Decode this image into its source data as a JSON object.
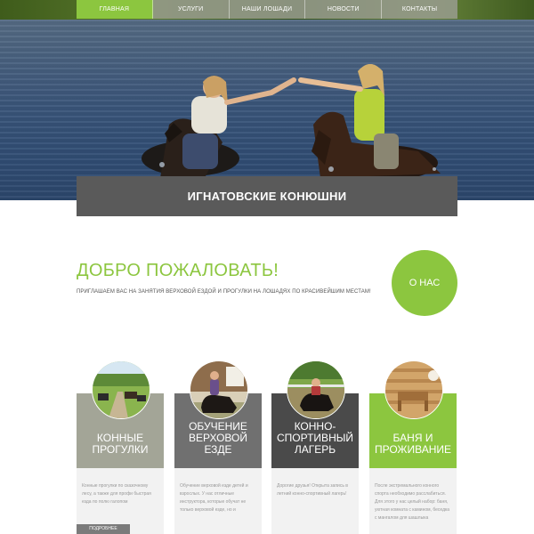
{
  "nav": {
    "items": [
      "Главная",
      "Услуги",
      "Наши лошади",
      "Новости",
      "Контакты"
    ],
    "active_color": "#8cc63f",
    "inactive_color": "#9a9d8c"
  },
  "hero": {
    "title": "ИГНАТОВСКИЕ КОНЮШНИ",
    "banner_color": "#5a5a5a"
  },
  "welcome": {
    "title": "ДОБРО ПОЖАЛОВАТЬ!",
    "text": "ПРИГЛАШАЕМ ВАС НА ЗАНЯТИЯ ВЕРХОВОЙ ЕЗДОЙ И ПРОГУЛКИ НА ЛОШАДЯХ ПО КРАСИВЕЙШИМ МЕСТАМ!",
    "about_button": "О НАС",
    "accent_color": "#8cc63f"
  },
  "services": [
    {
      "title": "КОННЫЕ ПРОГУЛКИ",
      "text": "Конные прогулки по сказочному лесу, а также для профи быстрая езда по полю галопом",
      "color": "#a3a597"
    },
    {
      "title": "ОБУЧЕНИЕ ВЕРХОВОЙ ЕЗДЕ",
      "text": "Обучение верховой езде детей и взрослых. У нас отличные инструктора, которые обучат не только верховой езде, но и",
      "color": "#707070"
    },
    {
      "title": "КОННО-СПОРТИВНЫЙ ЛАГЕРЬ",
      "text": "Дорогие друзья! Открыта запись в летний конно-спортивный лагерь!",
      "color": "#4a4a4a"
    },
    {
      "title": "БАНЯ И ПРОЖИВАНИЕ",
      "text": "После экстремального конного спорта необходимо расслабиться. Для этого у нас целый набор: баня, уютная комната с камином, беседка с мангалом для шашлыка",
      "color": "#8cc63f"
    }
  ],
  "more_button": "ПОДРОБНЕЕ"
}
